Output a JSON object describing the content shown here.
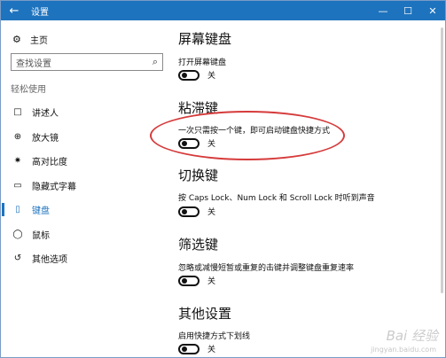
{
  "titlebar": {
    "title": "设置",
    "back_icon": "←",
    "minimize": "—",
    "maximize": "☐",
    "close": "✕",
    "color": "#1e73be"
  },
  "sidebar": {
    "home_label": "主页",
    "search_placeholder": "查找设置",
    "group_label": "轻松使用",
    "items": [
      {
        "label": "讲述人",
        "icon": "□"
      },
      {
        "label": "放大镜",
        "icon": "⊕"
      },
      {
        "label": "高对比度",
        "icon": "✷"
      },
      {
        "label": "隐藏式字幕",
        "icon": "▭"
      },
      {
        "label": "键盘",
        "icon": "▯"
      },
      {
        "label": "鼠标",
        "icon": "◯"
      },
      {
        "label": "其他选项",
        "icon": "↺"
      }
    ],
    "active_index": 4
  },
  "main": {
    "sections": [
      {
        "title": "屏幕键盘",
        "desc": "打开屏幕键盘",
        "toggle": "关"
      },
      {
        "title": "粘滞键",
        "desc": "一次只需按一个键，即可启动键盘快捷方式",
        "toggle": "关"
      },
      {
        "title": "切换键",
        "desc": "按 Caps Lock、Num Lock 和 Scroll Lock 时听到声音",
        "toggle": "关"
      },
      {
        "title": "筛选键",
        "desc": "忽略或减慢短暂或重复的击键并调整键盘重复速率",
        "toggle": "关"
      },
      {
        "title": "其他设置",
        "desc": "启用快捷方式下划线",
        "toggle": "关"
      }
    ]
  },
  "watermark": {
    "text": "Bai 经验",
    "sub": "jingyan.baidu.com"
  }
}
